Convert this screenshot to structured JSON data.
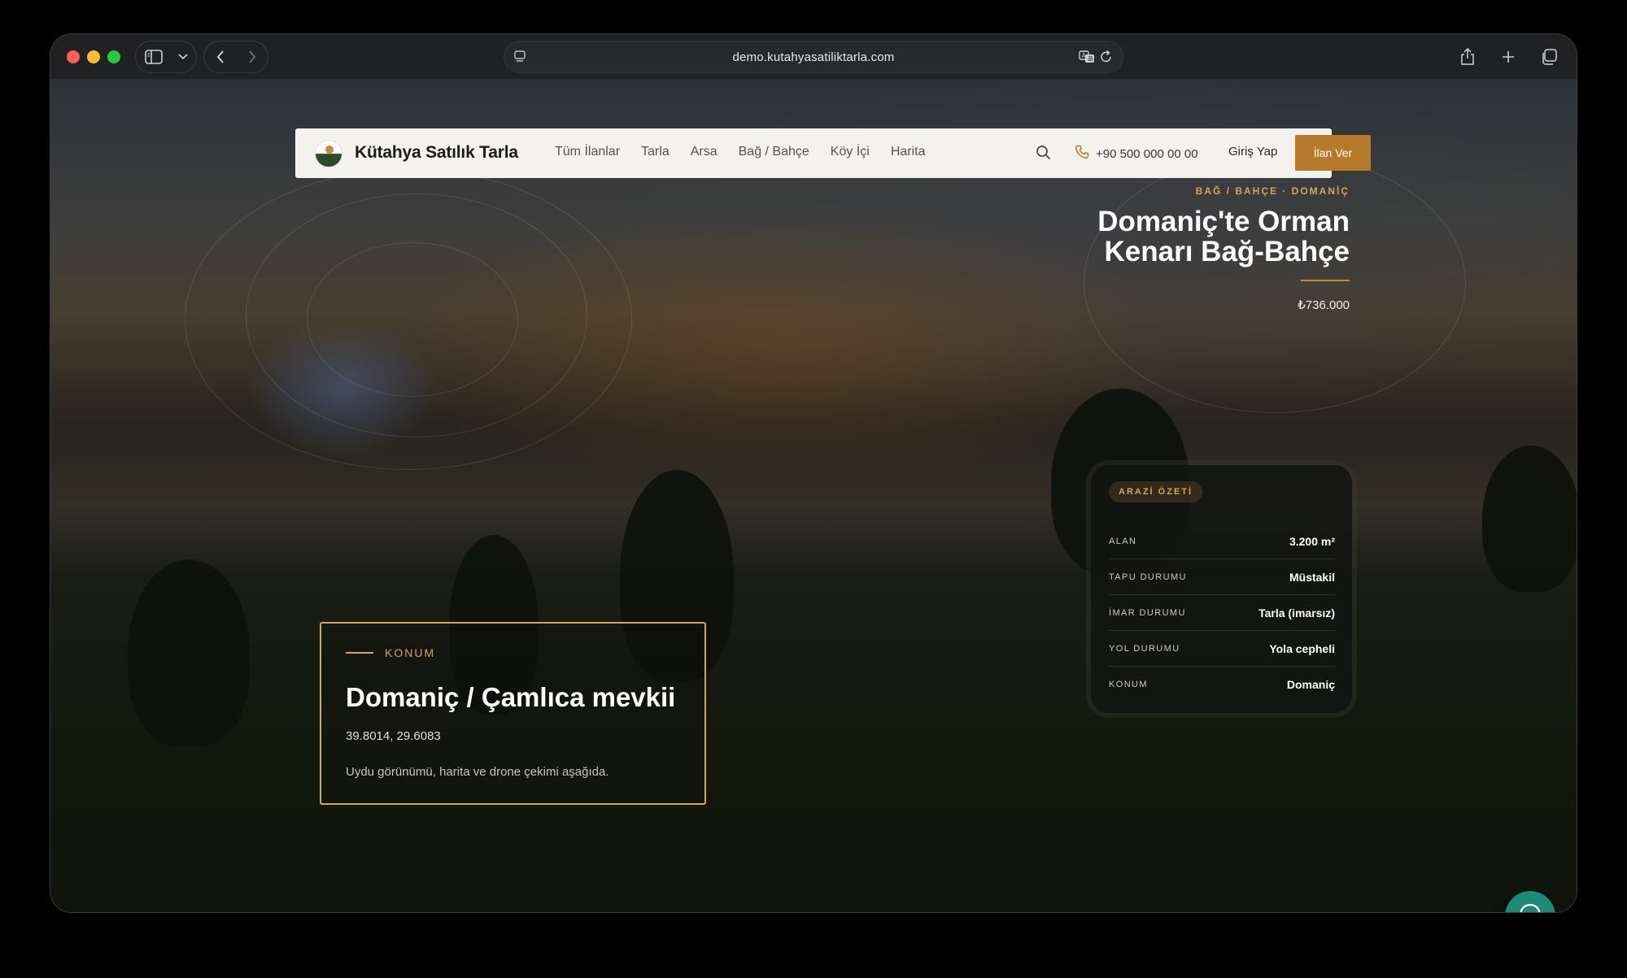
{
  "browser": {
    "url": "demo.kutahyasatiliktarla.com",
    "icons": {
      "sidebar": "sidebar-icon",
      "chevron": "chevron-down-icon",
      "back": "back-arrow-icon",
      "forward": "forward-arrow-icon",
      "translate": "translate-icon",
      "reload": "reload-icon",
      "share": "share-icon",
      "new_tab": "plus-icon",
      "tabs": "tabs-overview-icon"
    }
  },
  "site": {
    "brand": "Kütahya Satılık Tarla",
    "nav": [
      "Tüm İlanlar",
      "Tarla",
      "Arsa",
      "Bağ / Bahçe",
      "Köy İçi",
      "Harita"
    ],
    "phone": "+90 500 000 00 00",
    "login": "Giriş Yap",
    "cta": "İlan Ver",
    "accent": "#b57a2a"
  },
  "hero": {
    "kicker": "BAĞ / BAHÇE · DOMANİÇ",
    "title_line1": "Domaniç'te Orman",
    "title_line2": "Kenarı Bağ-Bahçe",
    "price": "₺736.000"
  },
  "summary": {
    "chip": "ARAZİ ÖZETİ",
    "rows": [
      {
        "label": "ALAN",
        "value": "3.200 m²"
      },
      {
        "label": "TAPU DURUMU",
        "value": "Müstakil"
      },
      {
        "label": "İMAR DURUMU",
        "value": "Tarla (imarsız)"
      },
      {
        "label": "YOL DURUMU",
        "value": "Yola cepheli"
      },
      {
        "label": "KONUM",
        "value": "Domaniç"
      }
    ]
  },
  "location": {
    "kicker": "KONUM",
    "title": "Domaniç / Çamlıca mevkii",
    "coords": "39.8014, 29.6083",
    "description": "Uydu görünümü, harita ve drone çekimi aşağıda."
  },
  "chat": {
    "icon": "chat-bubble-icon",
    "color": "#1e8a78"
  }
}
